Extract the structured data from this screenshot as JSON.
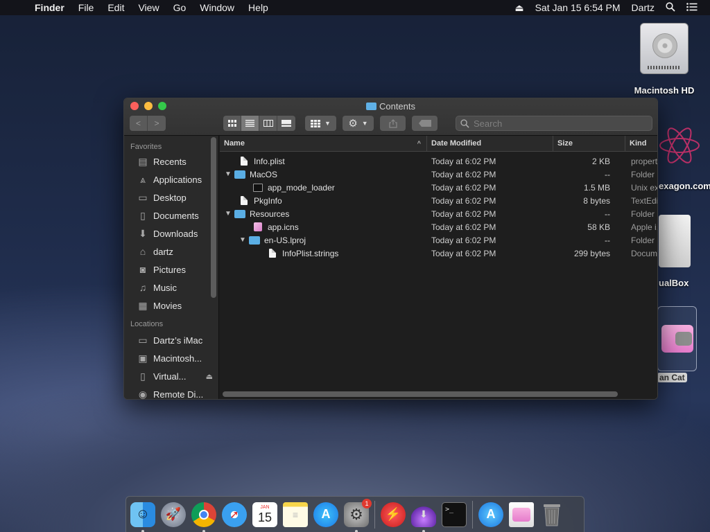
{
  "menubar": {
    "app_name": "Finder",
    "menus": [
      "File",
      "Edit",
      "View",
      "Go",
      "Window",
      "Help"
    ],
    "clock": "Sat Jan 15  6:54 PM",
    "user": "Dartz"
  },
  "desktop": {
    "icons": [
      {
        "label": "Macintosh HD"
      },
      {
        "label": "exagon.com"
      },
      {
        "label": "ualBox"
      },
      {
        "label": "an Cat"
      }
    ]
  },
  "window": {
    "title": "Contents",
    "search_placeholder": "Search",
    "sidebar": {
      "favorites_header": "Favorites",
      "favorites": [
        {
          "label": "Recents",
          "icon": "recents-icon"
        },
        {
          "label": "Applications",
          "icon": "applications-icon"
        },
        {
          "label": "Desktop",
          "icon": "desktop-icon"
        },
        {
          "label": "Documents",
          "icon": "documents-icon"
        },
        {
          "label": "Downloads",
          "icon": "downloads-icon"
        },
        {
          "label": "dartz",
          "icon": "home-icon"
        },
        {
          "label": "Pictures",
          "icon": "pictures-icon"
        },
        {
          "label": "Music",
          "icon": "music-icon"
        },
        {
          "label": "Movies",
          "icon": "movies-icon"
        }
      ],
      "locations_header": "Locations",
      "locations": [
        {
          "label": "Dartz’s iMac",
          "icon": "computer-icon"
        },
        {
          "label": "Macintosh...",
          "icon": "disk-icon"
        },
        {
          "label": "Virtual...",
          "icon": "disk-icon"
        },
        {
          "label": "Remote Di...",
          "icon": "remote-disc-icon"
        }
      ]
    },
    "columns": {
      "name": "Name",
      "date": "Date Modified",
      "size": "Size",
      "kind": "Kind"
    },
    "rows": [
      {
        "name": "Info.plist",
        "date": "Today at 6:02 PM",
        "size": "2 KB",
        "kind": "property list"
      },
      {
        "name": "MacOS",
        "date": "Today at 6:02 PM",
        "size": "--",
        "kind": "Folder"
      },
      {
        "name": "app_mode_loader",
        "date": "Today at 6:02 PM",
        "size": "1.5 MB",
        "kind": "Unix executable"
      },
      {
        "name": "PkgInfo",
        "date": "Today at 6:02 PM",
        "size": "8 bytes",
        "kind": "TextEdit"
      },
      {
        "name": "Resources",
        "date": "Today at 6:02 PM",
        "size": "--",
        "kind": "Folder"
      },
      {
        "name": "app.icns",
        "date": "Today at 6:02 PM",
        "size": "58 KB",
        "kind": "Apple i..."
      },
      {
        "name": "en-US.lproj",
        "date": "Today at 6:02 PM",
        "size": "--",
        "kind": "Folder"
      },
      {
        "name": "InfoPlist.strings",
        "date": "Today at 6:02 PM",
        "size": "299 bytes",
        "kind": "Document"
      }
    ]
  },
  "dock": {
    "apps": [
      "Finder",
      "Launchpad",
      "Chrome",
      "Safari",
      "Calendar",
      "Notes",
      "App Store",
      "System Preferences",
      "Flash",
      "Installer",
      "Terminal",
      "App Store Downloads",
      "Nyan Cat",
      "Trash"
    ],
    "calendar_day": "15",
    "calendar_month": "JAN",
    "system_prefs_badge": "1"
  }
}
